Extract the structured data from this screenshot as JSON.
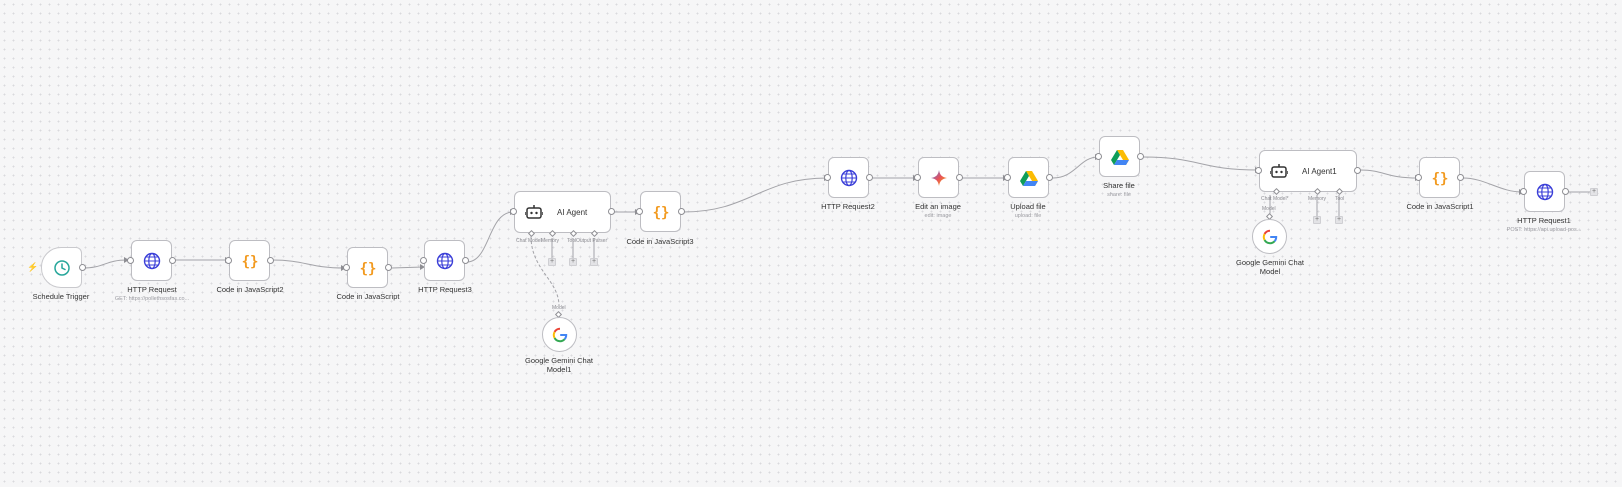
{
  "workflow": {
    "nodes": {
      "schedule_trigger": {
        "name": "Schedule Trigger",
        "icon": "clock-icon"
      },
      "http_request": {
        "name": "HTTP Request",
        "subtitle": "GET: https://pollethsosfas.co...",
        "icon": "globe-icon"
      },
      "code_js2": {
        "name": "Code in JavaScript2",
        "icon": "code-braces-icon"
      },
      "code_js": {
        "name": "Code in JavaScript",
        "icon": "code-braces-icon"
      },
      "http_request3": {
        "name": "HTTP Request3",
        "icon": "globe-icon"
      },
      "ai_agent": {
        "name": "AI Agent",
        "icon": "robot-icon",
        "ports": {
          "chat_model": "Chat Model",
          "memory": "Memory",
          "tool": "Tool",
          "output_parser": "Output Parser"
        }
      },
      "code_js3": {
        "name": "Code in JavaScript3",
        "icon": "code-braces-icon"
      },
      "gemini_model1": {
        "name": "Google Gemini Chat Model1",
        "port_label": "Model",
        "icon": "google-icon"
      },
      "http_request2": {
        "name": "HTTP Request2",
        "icon": "globe-icon"
      },
      "edit_image": {
        "name": "Edit an image",
        "subtitle": "edit: image",
        "icon": "gemini-sparkle-icon"
      },
      "upload_file": {
        "name": "Upload file",
        "subtitle": "upload: file",
        "icon": "google-drive-icon"
      },
      "share_file": {
        "name": "Share file",
        "subtitle": "share: file",
        "icon": "google-drive-icon"
      },
      "ai_agent1": {
        "name": "AI Agent1",
        "icon": "robot-icon",
        "ports": {
          "chat_model": "Chat Model*",
          "memory": "Memory",
          "tool": "Tool"
        }
      },
      "gemini_model": {
        "name": "Google Gemini Chat Model",
        "port_label": "Model",
        "icon": "google-icon"
      },
      "code_js1": {
        "name": "Code in JavaScript1",
        "icon": "code-braces-icon"
      },
      "http_request1": {
        "name": "HTTP Request1",
        "subtitle": "POST: https://api.upload-pos...",
        "icon": "globe-icon"
      }
    },
    "plus_symbol": "+",
    "trigger_marker": "⚡",
    "colors": {
      "canvas": "#f6f6f7",
      "edge": "#8e8e93",
      "node_border": "#bdbdc2",
      "globe": "#3b3fd8",
      "code": "#f29a1f",
      "clock": "#26a69a",
      "bolt": "#f1863b"
    }
  }
}
